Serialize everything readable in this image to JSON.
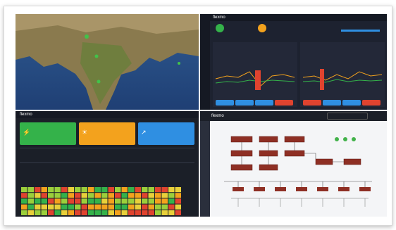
{
  "brand": "flexmo",
  "colors": {
    "green": "#34b24a",
    "orange": "#f3a21d",
    "blue": "#2f8fe2",
    "red": "#e0432f",
    "dark": "#1b1f28"
  },
  "top_right": {
    "kpi1": "",
    "kpi2": "",
    "panel_left_title": "",
    "panel_right_title": ""
  },
  "bottom_left": {
    "kpi_green": "",
    "kpi_orange": "",
    "kpi_blue": "",
    "section_title": ""
  },
  "bottom_right": {
    "header_title": "",
    "header_dropdown": ""
  },
  "icons": [
    "settings-icon",
    "user-icon",
    "chart-icon",
    "bolt-icon"
  ]
}
